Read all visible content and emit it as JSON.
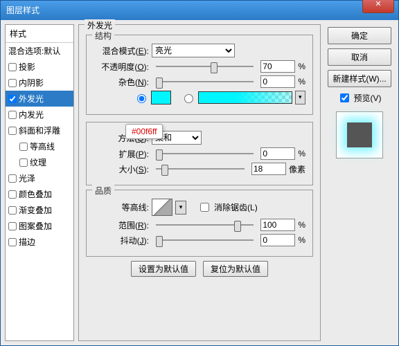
{
  "title": "图层样式",
  "sidebar": {
    "header": "样式",
    "blend_header": "混合选项:默认",
    "items": [
      {
        "label": "投影",
        "checked": false
      },
      {
        "label": "内阴影",
        "checked": false
      },
      {
        "label": "外发光",
        "checked": true,
        "selected": true
      },
      {
        "label": "内发光",
        "checked": false
      },
      {
        "label": "斜面和浮雕",
        "checked": false
      },
      {
        "label": "等高线",
        "checked": false,
        "sub": true
      },
      {
        "label": "纹理",
        "checked": false,
        "sub": true
      },
      {
        "label": "光泽",
        "checked": false
      },
      {
        "label": "颜色叠加",
        "checked": false
      },
      {
        "label": "渐变叠加",
        "checked": false
      },
      {
        "label": "图案叠加",
        "checked": false
      },
      {
        "label": "描边",
        "checked": false
      }
    ]
  },
  "panel": {
    "title": "外发光",
    "structure": {
      "legend": "结构",
      "blend_mode": {
        "label": "混合模式",
        "key": "E",
        "value": "亮光"
      },
      "opacity": {
        "label": "不透明度",
        "key": "O",
        "value": "70",
        "unit": "%",
        "pos": 56
      },
      "noise": {
        "label": "杂色",
        "key": "N",
        "value": "0",
        "unit": "%",
        "pos": 0
      },
      "color": "#00f6ff",
      "tooltip": "#00f6ff"
    },
    "elements": {
      "technique": {
        "label": "方法",
        "key": "Q",
        "value": "柔和"
      },
      "spread": {
        "label": "扩展",
        "key": "P",
        "value": "0",
        "unit": "%",
        "pos": 0
      },
      "size": {
        "label": "大小",
        "key": "S",
        "value": "18",
        "unit": "像素",
        "pos": 6
      }
    },
    "quality": {
      "legend": "品质",
      "contour": {
        "label": "等高线"
      },
      "antialias": {
        "label": "消除锯齿",
        "key": "L"
      },
      "range": {
        "label": "范围",
        "key": "R",
        "value": "100",
        "unit": "%",
        "pos": 80
      },
      "jitter": {
        "label": "抖动",
        "key": "J",
        "value": "0",
        "unit": "%",
        "pos": 0
      }
    },
    "buttons": {
      "set_default": "设置为默认值",
      "reset_default": "复位为默认值"
    }
  },
  "right": {
    "ok": "确定",
    "cancel": "取消",
    "new_style": "新建样式(W)...",
    "preview": "预览",
    "preview_key": "(V)"
  }
}
